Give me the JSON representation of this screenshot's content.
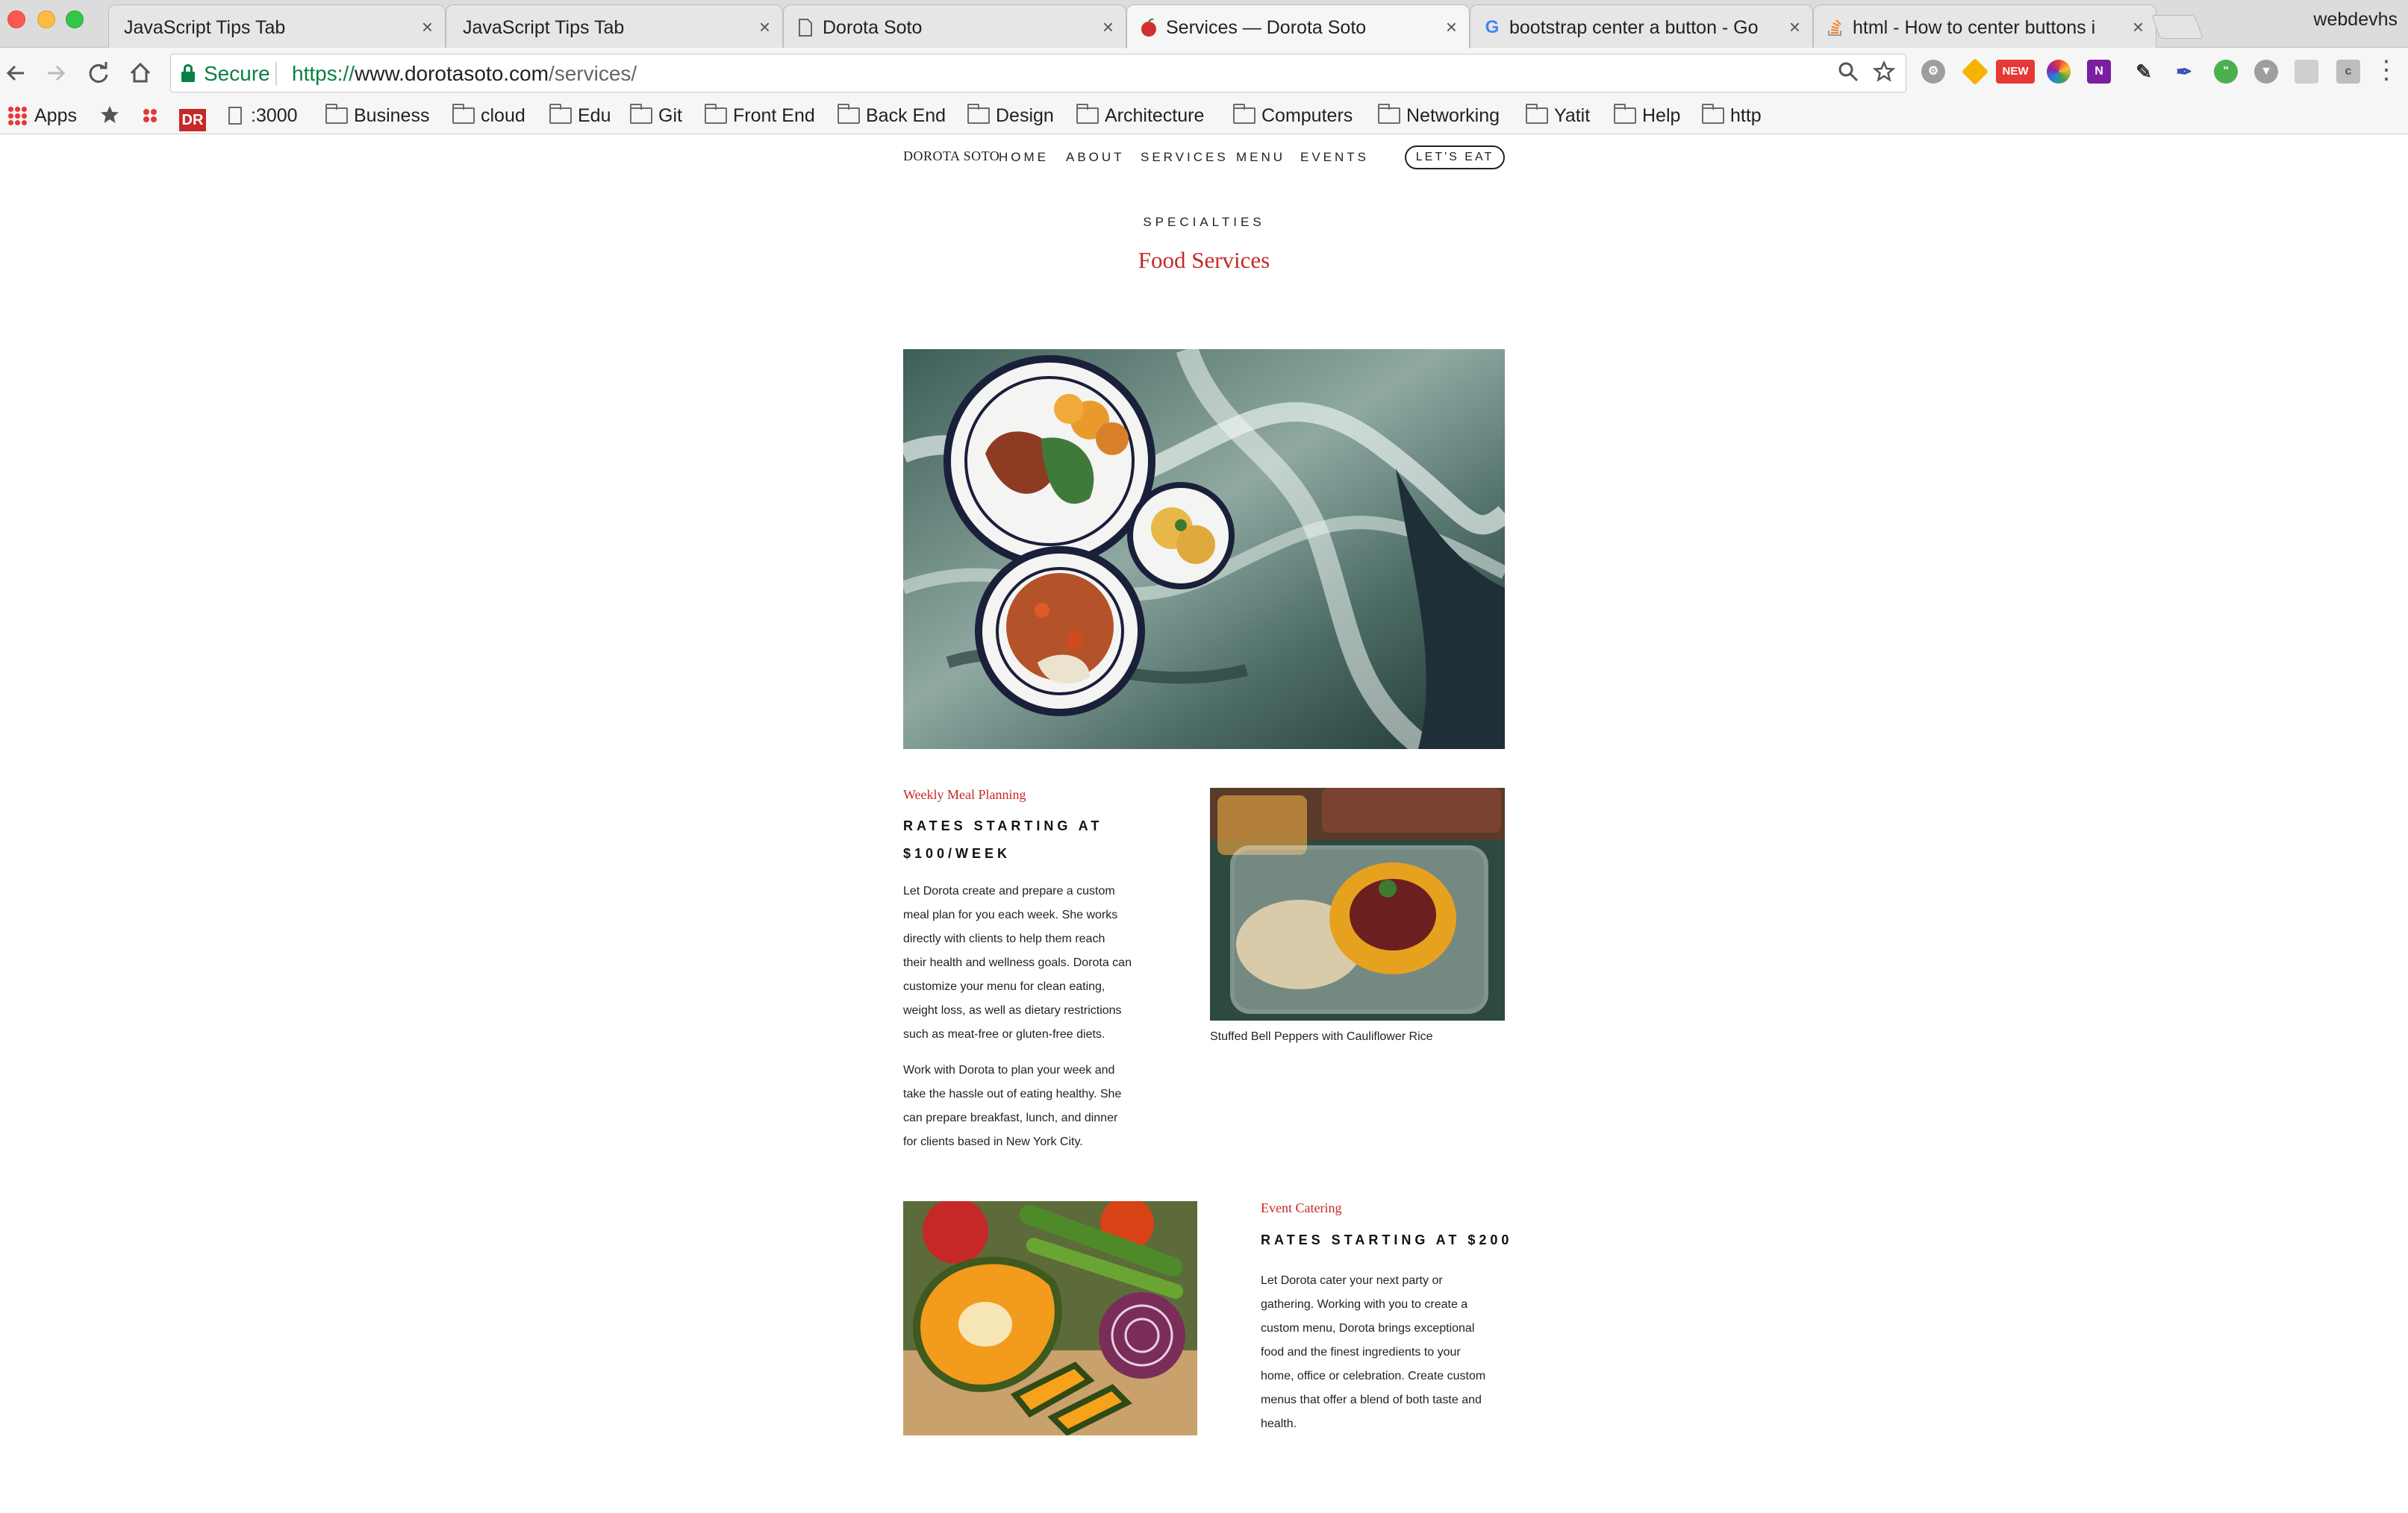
{
  "browser": {
    "tabs": [
      {
        "title": "JavaScript Tips Tab",
        "close": "×"
      },
      {
        "title": "JavaScript Tips Tab",
        "close": "×"
      },
      {
        "title": "Dorota Soto",
        "close": "×"
      },
      {
        "title": "Services — Dorota Soto",
        "close": "×"
      },
      {
        "title": "bootstrap center a button - Go",
        "close": "×"
      },
      {
        "title": "html - How to center buttons i",
        "close": "×"
      }
    ],
    "profile": "webdevhs",
    "secure_label": "Secure",
    "url_scheme": "https://",
    "url_host": "www.dorotasoto.com",
    "url_path": "/services/",
    "ext_badge": "NEW"
  },
  "bookmarks": [
    {
      "label": "Apps"
    },
    {
      "label": ":3000"
    },
    {
      "label": "Business"
    },
    {
      "label": "cloud"
    },
    {
      "label": "Edu"
    },
    {
      "label": "Git"
    },
    {
      "label": "Front End"
    },
    {
      "label": "Back End"
    },
    {
      "label": "Design"
    },
    {
      "label": "Architecture"
    },
    {
      "label": "Computers"
    },
    {
      "label": "Networking"
    },
    {
      "label": "Yatit"
    },
    {
      "label": "Help"
    },
    {
      "label": "http"
    }
  ],
  "site": {
    "logo": "DOROTA SOTO",
    "nav": [
      "HOME",
      "ABOUT",
      "SERVICES",
      "MENU",
      "EVENTS"
    ],
    "cta": "LET'S EAT",
    "eyebrow": "SPECIALTIES",
    "title": "Food Services",
    "services": [
      {
        "title": "Weekly Meal Planning",
        "rate_line1": "RATES STARTING AT",
        "rate_line2": "$100/WEEK",
        "p1": [
          "Let Dorota create and prepare a custom",
          "meal plan for you each week. She works",
          "directly with clients to help them reach",
          "their health and wellness goals. Dorota can",
          "customize your menu for clean eating,",
          "weight loss, as well as dietary restrictions",
          "such as meat-free or gluten-free diets."
        ],
        "p2": [
          "Work with Dorota to plan your week and",
          "take the hassle out of eating healthy. She",
          "can prepare breakfast, lunch, and dinner",
          "for clients based in New York City."
        ],
        "image_caption": "Stuffed Bell Peppers with Cauliflower Rice"
      },
      {
        "title": "Event Catering",
        "rate_line1": "RATES STARTING AT $200",
        "p1": [
          "Let Dorota cater your next party or",
          "gathering. Working with you to create a",
          "custom menu, Dorota brings exceptional",
          "food and the finest ingredients to your",
          "home, office or celebration. Create custom",
          "menus that offer a blend of both taste and",
          "health."
        ]
      }
    ]
  }
}
